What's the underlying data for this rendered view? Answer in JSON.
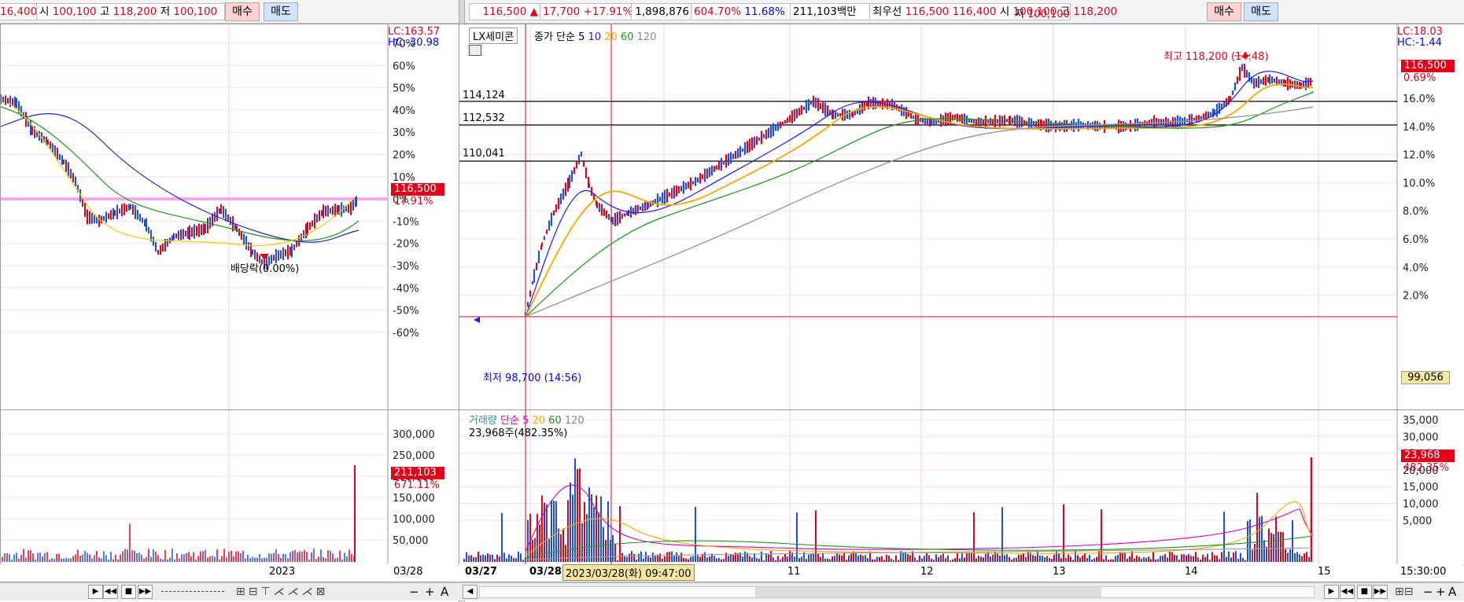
{
  "left_header": {
    "partial_price": "16,400",
    "open_label": "시",
    "open": "100,100",
    "high_label": "고",
    "high": "118,200",
    "low_label": "저",
    "low": "100,100",
    "buy_label": "매수",
    "sell_label": "매도"
  },
  "right_header": {
    "price": "116,500",
    "arrow": "▲",
    "change": "17,700",
    "change_pct": "+17.91%",
    "volume": "1,898,876",
    "volume_ratio": "604.70%",
    "turnover": "11.68%",
    "amount": "211,103백만",
    "best_label": "최우선",
    "best_ask": "116,500",
    "best_bid": "116,400",
    "open_label": "시",
    "open": "100,100",
    "high_label": "고",
    "high": "118,200",
    "low_label": "저",
    "low": "100,100",
    "buy_label": "매수",
    "sell_label": "매도"
  },
  "left_chart": {
    "lc": "LC:163.57",
    "hc": "HC:-30.98",
    "y_ticks": [
      "70%",
      "60%",
      "50%",
      "40%",
      "30%",
      "20%",
      "10%",
      "0%",
      "-10%",
      "-20%",
      "-30%",
      "-40%",
      "-50%",
      "-60%"
    ],
    "price_tag": "116,500",
    "price_tag_pct": "17.91%",
    "annotation": "배당락(0.00%)",
    "vol_ticks": [
      "300,000",
      "250,000",
      "200,000",
      "150,000",
      "100,000",
      "50,000"
    ],
    "vol_tag": "211,103",
    "vol_tag_pct": "671.11%",
    "x_label": "2023",
    "date_label": "03/28"
  },
  "main_chart": {
    "stock_name": "LX세미콘",
    "indicator_label": "종가 단순",
    "ma_periods": [
      "5",
      "10",
      "20",
      "60",
      "120"
    ],
    "ma_colors": [
      "#1a1aff",
      "#000000",
      "#f5a800",
      "#1a9a1a",
      "#888888"
    ],
    "lc": "LC:18.03",
    "hc": "HC:-1.44",
    "y_ticks": [
      "16.0%",
      "14.0%",
      "12.0%",
      "10.0%",
      "8.0%",
      "6.0%",
      "4.0%",
      "2.0%"
    ],
    "high_note": "최고 118,200 (14:48)",
    "low_note": "최저 98,700 (14:56)",
    "hlines": [
      "114,124",
      "112,532",
      "110,041"
    ],
    "price_tag": "116,500",
    "price_tag_pct": "0.69%",
    "base_tag": "99,056",
    "x_labels": [
      "03/27",
      "03/28",
      "11",
      "12",
      "13",
      "14",
      "15"
    ],
    "time_label": "15:30:00",
    "crosshair_label": "2023/03/28(화) 09:47:00"
  },
  "volume_chart": {
    "title": "거래량",
    "indicator_label": "단순",
    "ma_periods": [
      "5",
      "20",
      "60",
      "120"
    ],
    "info": "23,968주(482.35%)",
    "y_ticks": [
      "35,000",
      "30,000",
      "25,000",
      "20,000",
      "15,000",
      "10,000",
      "5,000"
    ],
    "vol_tag": "23,968",
    "vol_tag_pct": "482.35%"
  },
  "toolbar": {
    "play": "▶",
    "rewind": "◀◀",
    "stop": "■",
    "forward": "▶▶",
    "zoom_out": "−",
    "zoom_in": "+",
    "text_tool": "A",
    "scroll_left": "◀"
  }
}
